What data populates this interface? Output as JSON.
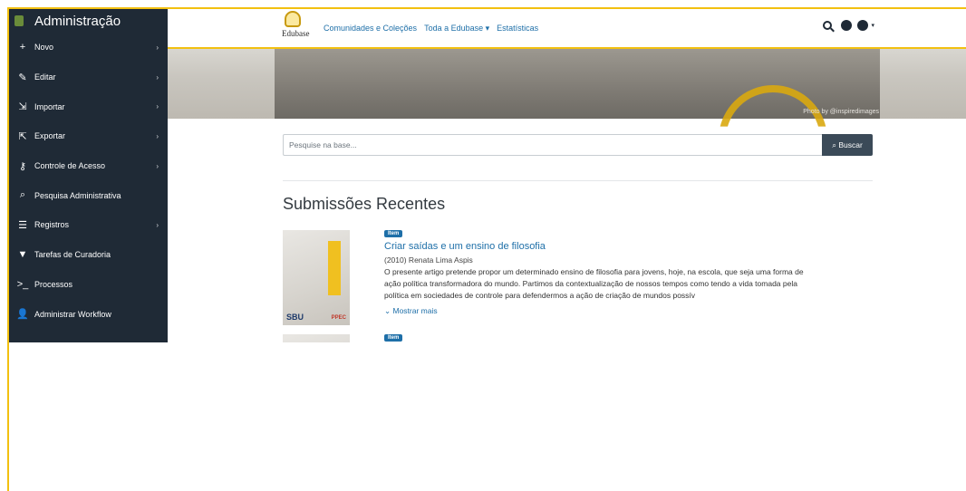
{
  "sidebar": {
    "title": "Administração",
    "items": [
      {
        "label": "Novo",
        "icon": "plus-icon",
        "has_submenu": true
      },
      {
        "label": "Editar",
        "icon": "pencil-icon",
        "has_submenu": true
      },
      {
        "label": "Importar",
        "icon": "import-icon",
        "has_submenu": true
      },
      {
        "label": "Exportar",
        "icon": "export-icon",
        "has_submenu": true
      },
      {
        "label": "Controle de Acesso",
        "icon": "key-icon",
        "has_submenu": true
      },
      {
        "label": "Pesquisa Administrativa",
        "icon": "search-icon",
        "has_submenu": false
      },
      {
        "label": "Registros",
        "icon": "list-icon",
        "has_submenu": true
      },
      {
        "label": "Tarefas de Curadoria",
        "icon": "filter-icon",
        "has_submenu": false
      },
      {
        "label": "Processos",
        "icon": "terminal-icon",
        "has_submenu": false
      },
      {
        "label": "Administrar Workflow",
        "icon": "user-cog-icon",
        "has_submenu": false
      }
    ]
  },
  "header": {
    "logo_text": "Edubase",
    "nav": [
      "Comunidades e Coleções",
      "Toda a Edubase ▾",
      "Estatísticas"
    ]
  },
  "banner": {
    "credit": "Photo by @inspiredimages"
  },
  "search": {
    "placeholder": "Pesquise na base...",
    "button_label": "Buscar"
  },
  "main": {
    "section_title": "Submissões Recentes",
    "items": [
      {
        "badge": "Item",
        "title": "Criar saídas e um ensino de filosofia",
        "meta": "(2010) Renata Lima Aspis",
        "abstract": "O presente artigo pretende propor um determinado ensino de filosofia para jovens, hoje, na escola, que seja uma forma de ação política transformadora do mundo. Partimos da contextualização de nossos tempos como tendo a vida tomada pela política em sociedades de controle para defendermos a ação de criação de mundos possív",
        "more_label": "Mostrar mais",
        "thumb_sbu": "SBU",
        "thumb_ppec": "PPEC"
      },
      {
        "badge": "Item"
      }
    ]
  },
  "colors": {
    "accent": "#f2c010",
    "sidebar_bg": "#1f2a36",
    "link": "#1e6fa8"
  }
}
